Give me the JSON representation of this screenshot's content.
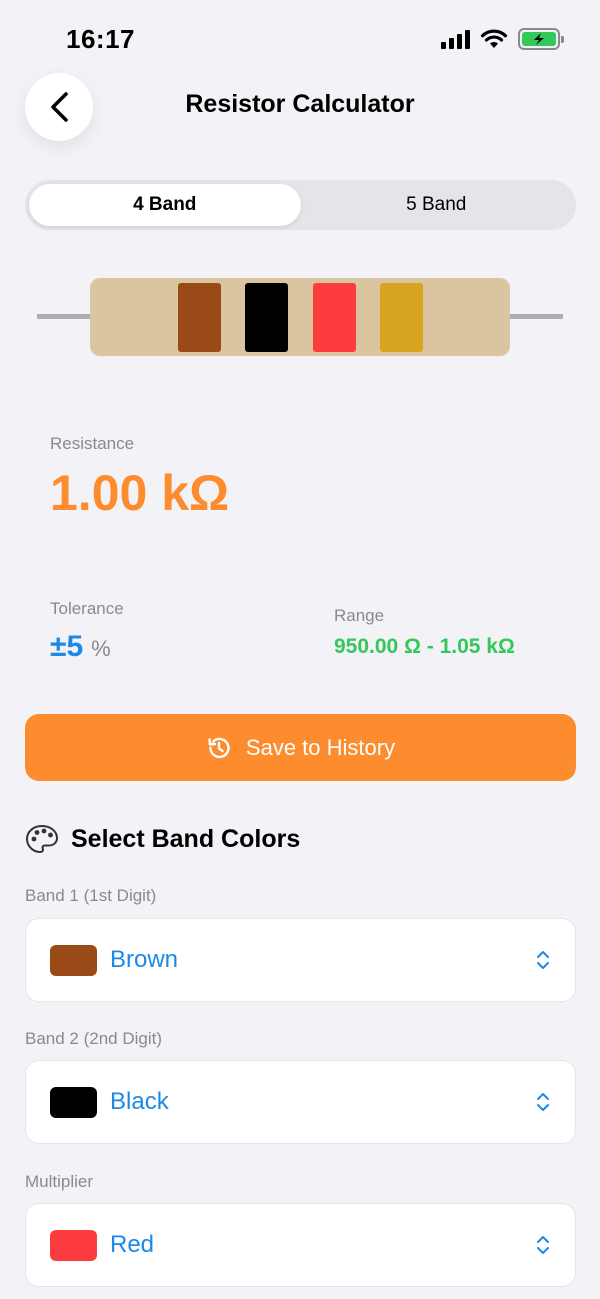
{
  "status_bar": {
    "time": "16:17"
  },
  "header": {
    "title": "Resistor Calculator"
  },
  "segments": [
    {
      "label": "4 Band",
      "active": true
    },
    {
      "label": "5 Band",
      "active": false
    }
  ],
  "resistor": {
    "body_color": "#dbc4a0",
    "bands": [
      "#9a4a16",
      "#000000",
      "#fe3b3e",
      "#d9a520"
    ]
  },
  "result": {
    "resistance_label": "Resistance",
    "resistance_value": "1.00 kΩ",
    "tolerance_label": "Tolerance",
    "tolerance_value": "±5",
    "tolerance_unit": "%",
    "range_label": "Range",
    "range_value": "950.00 Ω - 1.05 kΩ"
  },
  "save_button": {
    "label": "Save to History",
    "icon": "history-icon"
  },
  "band_section": {
    "title": "Select Band Colors",
    "icon": "palette-icon",
    "fields": [
      {
        "label": "Band 1 (1st Digit)",
        "value": "Brown",
        "color": "#9a4a16"
      },
      {
        "label": "Band 2 (2nd Digit)",
        "value": "Black",
        "color": "#000000"
      },
      {
        "label": "Multiplier",
        "value": "Red",
        "color": "#fe3b3e"
      }
    ]
  },
  "colors": {
    "accent": "#fd8c2e",
    "link": "#1c89e8",
    "success": "#34c759"
  }
}
